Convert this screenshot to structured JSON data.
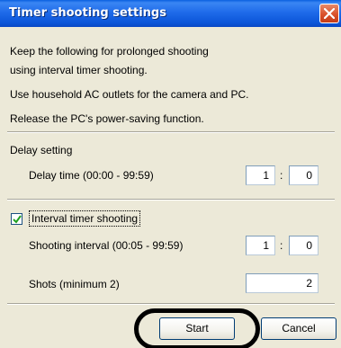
{
  "window": {
    "title": "Timer shooting settings"
  },
  "info": {
    "line1": "Keep the following for prolonged shooting",
    "line2": "using interval timer shooting.",
    "line3": "Use household AC outlets for the camera and PC.",
    "line4": "Release the PC's power-saving function."
  },
  "delay": {
    "section_label": "Delay setting",
    "time_label": "Delay time (00:00 - 99:59)",
    "minutes": "1",
    "seconds": "0"
  },
  "interval": {
    "checkbox_label": "Interval timer shooting",
    "checked": true,
    "shooting_interval_label": "Shooting interval (00:05 - 99:59)",
    "minutes": "1",
    "seconds": "0",
    "shots_label": "Shots (minimum 2)",
    "shots_value": "2"
  },
  "buttons": {
    "start": "Start",
    "cancel": "Cancel"
  },
  "colon": ":"
}
